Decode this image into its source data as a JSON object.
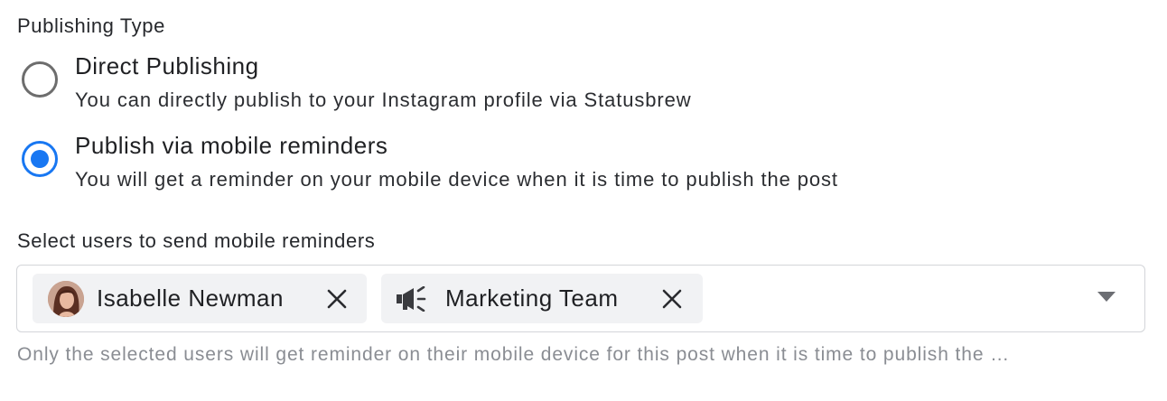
{
  "publishing": {
    "label": "Publishing Type",
    "options": [
      {
        "title": "Direct Publishing",
        "description": "You can directly publish to your Instagram profile via Statusbrew",
        "selected": false
      },
      {
        "title": "Publish via mobile reminders",
        "description": "You will get a reminder on your mobile device when it is time to publish the post",
        "selected": true
      }
    ]
  },
  "reminders": {
    "label": "Select users to send mobile reminders",
    "selected_users": [
      {
        "name": "Isabelle Newman",
        "icon": "avatar"
      },
      {
        "name": "Marketing Team",
        "icon": "megaphone-icon"
      }
    ],
    "hint": "Only the selected users will get reminder on their mobile device for this post when it is time to publish the …"
  },
  "colors": {
    "accent": "#1877f2",
    "chip_bg": "#f1f2f4",
    "hint_text": "#8a8d93"
  }
}
